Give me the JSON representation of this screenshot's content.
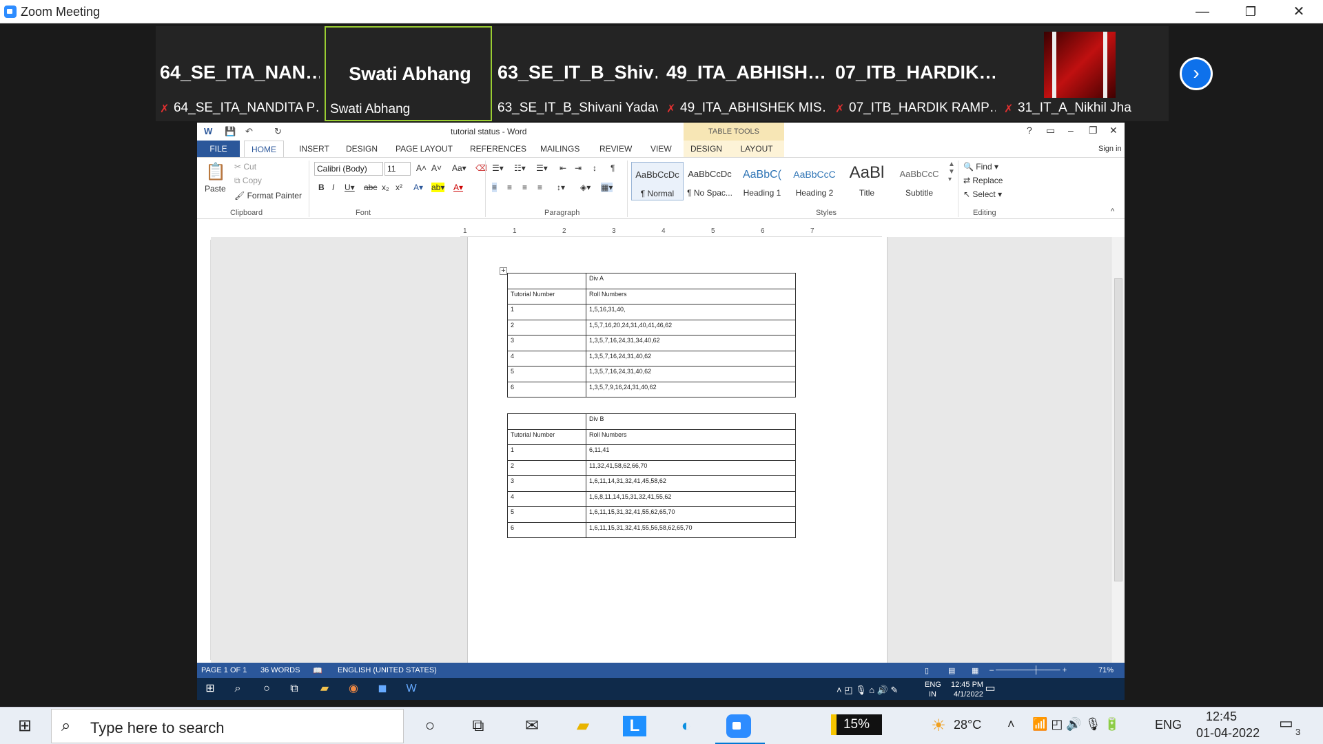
{
  "zoom": {
    "title": "Zoom Meeting",
    "controls": {
      "minimize": "—",
      "restore": "❐",
      "close": "✕"
    },
    "participants": [
      {
        "big": "64_SE_ITA_NAN…",
        "label": "64_SE_ITA_NANDITA P…",
        "muted": true,
        "active": false
      },
      {
        "big": "Swati Abhang",
        "label": "Swati Abhang",
        "muted": false,
        "active": true
      },
      {
        "big": "63_SE_IT_B_Shiv…",
        "label": "63_SE_IT_B_Shivani Yadav",
        "muted": false,
        "active": false
      },
      {
        "big": "49_ITA_ABHISH…",
        "label": "49_ITA_ABHISHEK MIS…",
        "muted": true,
        "active": false
      },
      {
        "big": "07_ITB_HARDIK…",
        "label": "07_ITB_HARDIK RAMP…",
        "muted": true,
        "active": false
      },
      {
        "big": "",
        "label": "31_IT_A_Nikhil Jha",
        "muted": true,
        "active": false
      }
    ],
    "next_icon": "chevron-right-icon"
  },
  "word": {
    "title": "tutorial status - Word",
    "table_tools": "TABLE TOOLS",
    "help": "?",
    "sign_in": "Sign in",
    "tabs": [
      "FILE",
      "HOME",
      "INSERT",
      "DESIGN",
      "PAGE LAYOUT",
      "REFERENCES",
      "MAILINGS",
      "REVIEW",
      "VIEW",
      "DESIGN",
      "LAYOUT"
    ],
    "clipboard": {
      "paste": "Paste",
      "cut": "Cut",
      "copy": "Copy",
      "format_painter": "Format Painter",
      "group": "Clipboard"
    },
    "font": {
      "name": "Calibri (Body)",
      "size": "11",
      "group": "Font"
    },
    "paragraph": {
      "group": "Paragraph"
    },
    "styles": {
      "group": "Styles",
      "items": [
        {
          "preview": "AaBbCcDc",
          "name": "¶ Normal"
        },
        {
          "preview": "AaBbCcDc",
          "name": "¶ No Spac..."
        },
        {
          "preview": "AaBbC(",
          "name": "Heading 1"
        },
        {
          "preview": "AaBbCcC",
          "name": "Heading 2"
        },
        {
          "preview": "AaBl",
          "name": "Title"
        },
        {
          "preview": "AaBbCcC",
          "name": "Subtitle"
        }
      ]
    },
    "editing": {
      "find": "Find",
      "replace": "Replace",
      "select": "Select",
      "group": "Editing"
    },
    "ruler_numbers": [
      "1",
      "1",
      "2",
      "3",
      "4",
      "5",
      "6",
      "7"
    ],
    "tables": [
      {
        "division": "Div A",
        "headers": [
          "Tutorial Number",
          "Roll Numbers"
        ],
        "rows": [
          [
            "1",
            "1,5,16,31,40,"
          ],
          [
            "2",
            "1,5,7,16,20,24,31,40,41,46,62"
          ],
          [
            "3",
            "1,3,5,7,16,24,31,34,40,62"
          ],
          [
            "4",
            "1,3,5,7,16,24,31,40,62"
          ],
          [
            "5",
            "1,3,5,7,16,24,31,40,62"
          ],
          [
            "6",
            "1,3,5,7,9,16,24,31,40,62"
          ]
        ]
      },
      {
        "division": "Div B",
        "headers": [
          "Tutorial Number",
          "Roll Numbers"
        ],
        "rows": [
          [
            "1",
            "6,11,41"
          ],
          [
            "2",
            "11,32,41,58,62,66,70"
          ],
          [
            "3",
            "1,6,11,14,31,32,41,45,58,62"
          ],
          [
            "4",
            "1,6,8,11,14,15,31,32,41,55,62"
          ],
          [
            "5",
            "1,6,11,15,31,32,41,55,62,65,70"
          ],
          [
            "6",
            "1,6,11,15,31,32,41,55,56,58,62,65,70"
          ]
        ]
      }
    ],
    "status": {
      "page": "PAGE 1 OF 1",
      "words": "36 WORDS",
      "lang": "ENGLISH (UNITED STATES)",
      "zoom": "71%"
    },
    "inner_taskbar": {
      "lang": "ENG",
      "region": "IN",
      "time": "12:45 PM",
      "date": "4/1/2022"
    }
  },
  "taskbar": {
    "search_placeholder": "Type here to search",
    "battery": "15%",
    "weather": "28°C",
    "lang": "ENG",
    "time": "12:45",
    "date": "01-04-2022",
    "notifications": "3"
  }
}
